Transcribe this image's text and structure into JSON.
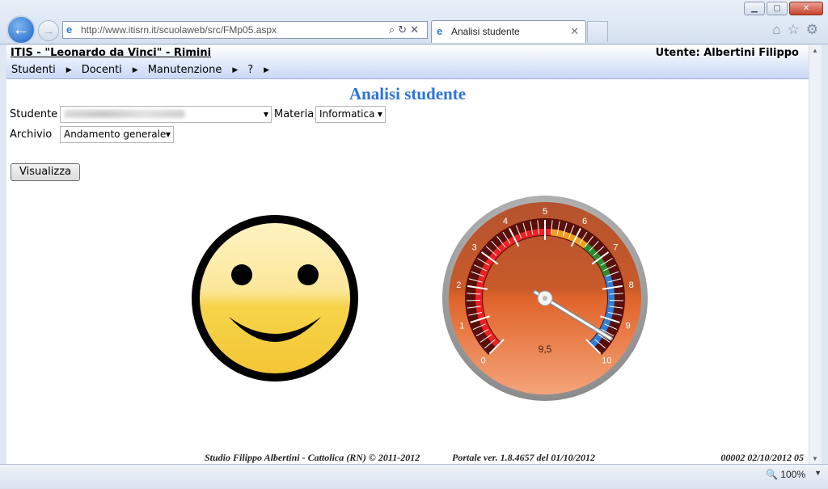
{
  "browser": {
    "url": "http://www.itisrn.it/scuolaweb/src/FMp05.aspx",
    "url_host": "itisrn.it",
    "tab_title": "Analisi studente",
    "zoom": "100%"
  },
  "header": {
    "site_title": "ITIS - \"Leonardo da Vinci\" - Rimini",
    "user": "Utente: Albertini Filippo"
  },
  "menu": [
    {
      "label": "Studenti"
    },
    {
      "label": "Docenti"
    },
    {
      "label": "Manutenzione"
    },
    {
      "label": "?"
    }
  ],
  "page": {
    "heading": "Analisi studente",
    "student_label": "Studente",
    "subject_label": "Materia",
    "subject_value": "Informatica",
    "archive_label": "Archivio",
    "archive_value": "Andamento generale",
    "view_button": "Visualizza"
  },
  "gauge": {
    "value": 9.5,
    "value_label": "9,5",
    "min": 0,
    "max": 10,
    "tick_labels": [
      "0",
      "1",
      "2",
      "3",
      "4",
      "5",
      "6",
      "7",
      "8",
      "9",
      "10"
    ],
    "colors": {
      "low": "#ee2020",
      "mid": "#f0a020",
      "good": "#2e8b2e",
      "high": "#2f7fd8"
    }
  },
  "smiley": {
    "mood": "happy",
    "face_color": "#f6d44a"
  },
  "footer": {
    "studio": "Studio Filippo Albertini - Cattolica (RN) © 2011-2012",
    "version": "Portale ver. 1.8.4657 del 01/10/2012",
    "right": "00002  02/10/2012  05"
  }
}
